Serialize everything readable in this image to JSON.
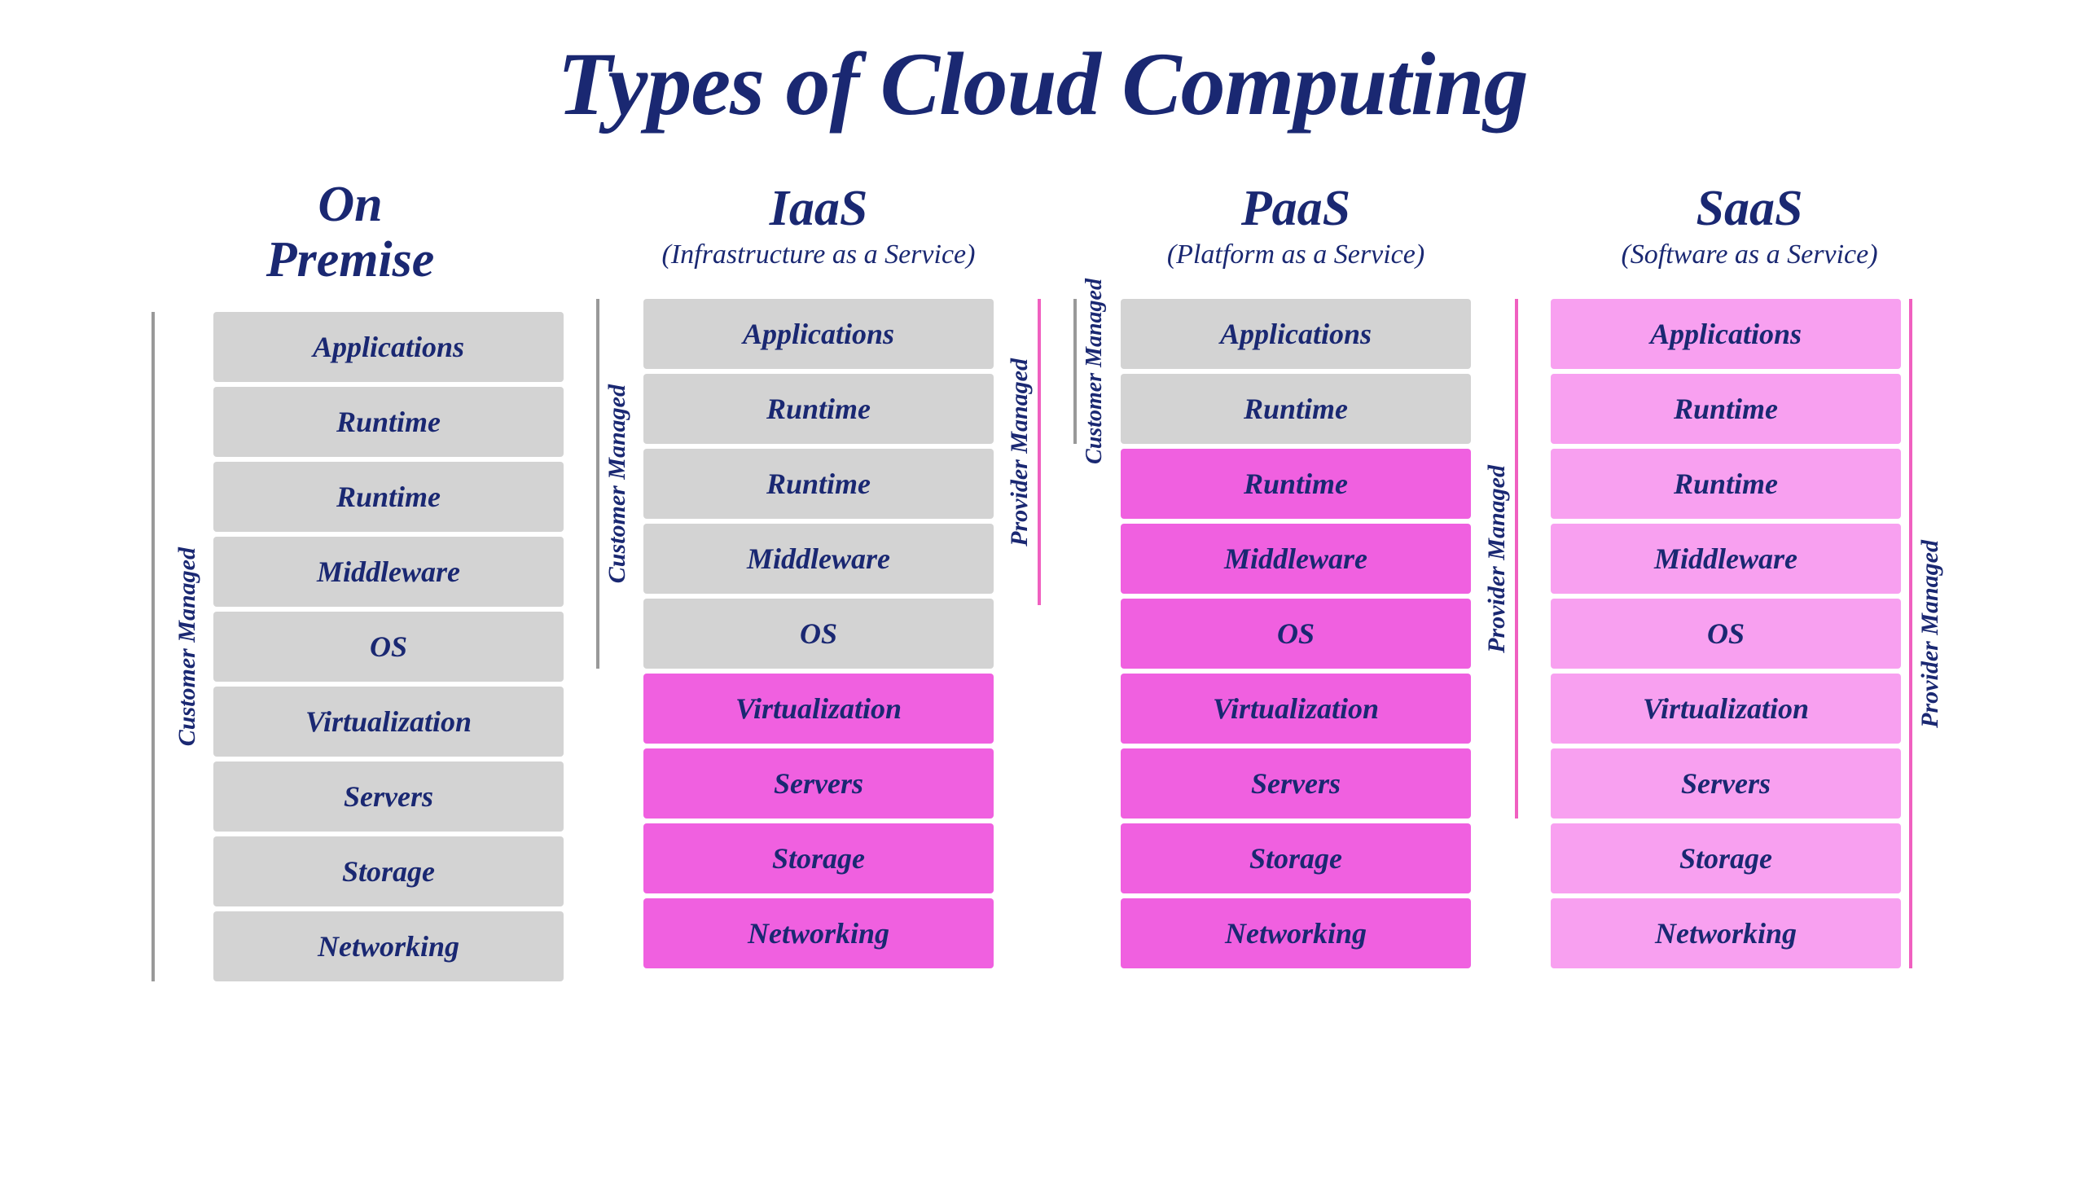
{
  "title": "Types of Cloud Computing",
  "columns": [
    {
      "id": "on-premise",
      "title": "On\nPremise",
      "subtitle": "",
      "left_label": "Customer Managed",
      "right_label": "",
      "cells": [
        {
          "label": "Applications",
          "color": "gray"
        },
        {
          "label": "Runtime",
          "color": "gray"
        },
        {
          "label": "Runtime",
          "color": "gray"
        },
        {
          "label": "Middleware",
          "color": "gray"
        },
        {
          "label": "OS",
          "color": "gray"
        },
        {
          "label": "Virtualization",
          "color": "gray"
        },
        {
          "label": "Servers",
          "color": "gray"
        },
        {
          "label": "Storage",
          "color": "gray"
        },
        {
          "label": "Networking",
          "color": "gray"
        }
      ]
    },
    {
      "id": "iaas",
      "title": "IaaS",
      "subtitle": "(Infrastructure as a Service)",
      "left_label": "Customer Managed",
      "right_label": "Provider Managed",
      "customer_rows": 5,
      "provider_rows": 4,
      "cells": [
        {
          "label": "Applications",
          "color": "gray"
        },
        {
          "label": "Runtime",
          "color": "gray"
        },
        {
          "label": "Runtime",
          "color": "gray"
        },
        {
          "label": "Middleware",
          "color": "gray"
        },
        {
          "label": "OS",
          "color": "gray"
        },
        {
          "label": "Virtualization",
          "color": "pink"
        },
        {
          "label": "Servers",
          "color": "pink"
        },
        {
          "label": "Storage",
          "color": "pink"
        },
        {
          "label": "Networking",
          "color": "pink"
        }
      ]
    },
    {
      "id": "paas",
      "title": "PaaS",
      "subtitle": "(Platform as a Service)",
      "left_label": "Customer Managed",
      "right_label": "Provider Managed",
      "customer_rows": 2,
      "provider_rows": 7,
      "cells": [
        {
          "label": "Applications",
          "color": "gray"
        },
        {
          "label": "Runtime",
          "color": "gray"
        },
        {
          "label": "Runtime",
          "color": "pink"
        },
        {
          "label": "Middleware",
          "color": "pink"
        },
        {
          "label": "OS",
          "color": "pink"
        },
        {
          "label": "Virtualization",
          "color": "pink"
        },
        {
          "label": "Servers",
          "color": "pink"
        },
        {
          "label": "Storage",
          "color": "pink"
        },
        {
          "label": "Networking",
          "color": "pink"
        }
      ]
    },
    {
      "id": "saas",
      "title": "SaaS",
      "subtitle": "(Software as a Service)",
      "left_label": "",
      "right_label": "Provider Managed",
      "customer_rows": 0,
      "provider_rows": 9,
      "cells": [
        {
          "label": "Applications",
          "color": "pink-light"
        },
        {
          "label": "Runtime",
          "color": "pink-light"
        },
        {
          "label": "Runtime",
          "color": "pink-light"
        },
        {
          "label": "Middleware",
          "color": "pink-light"
        },
        {
          "label": "OS",
          "color": "pink-light"
        },
        {
          "label": "Virtualization",
          "color": "pink-light"
        },
        {
          "label": "Servers",
          "color": "pink-light"
        },
        {
          "label": "Storage",
          "color": "pink-light"
        },
        {
          "label": "Networking",
          "color": "pink-light"
        }
      ]
    }
  ],
  "colors": {
    "gray_cell": "#d3d3d3",
    "pink_cell": "#ee44dd",
    "pink_light_cell": "#f0a0ee",
    "title_color": "#1a2872",
    "bracket_color": "#f060c0",
    "bracket_gray": "#999999"
  }
}
